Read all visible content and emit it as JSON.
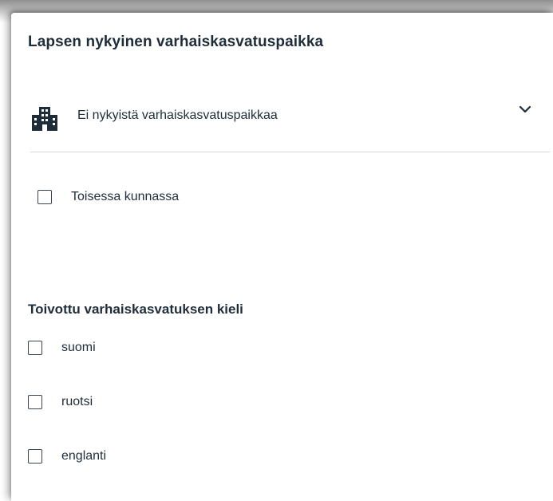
{
  "section": {
    "title": "Lapsen nykyinen varhaiskasvatuspaikka"
  },
  "placement_select": {
    "icon": "building-icon",
    "value": "Ei nykyistä varhaiskasvatuspaikkaa",
    "chevron": "chevron-down-icon"
  },
  "other_municipality": {
    "label": "Toisessa kunnassa",
    "checked": false
  },
  "language": {
    "title": "Toivottu varhaiskasvatuksen kieli",
    "options": [
      {
        "label": "suomi",
        "checked": false
      },
      {
        "label": "ruotsi",
        "checked": false
      },
      {
        "label": "englanti",
        "checked": false
      }
    ]
  },
  "colors": {
    "text": "#1f2d3a",
    "divider": "#d4d7db"
  }
}
